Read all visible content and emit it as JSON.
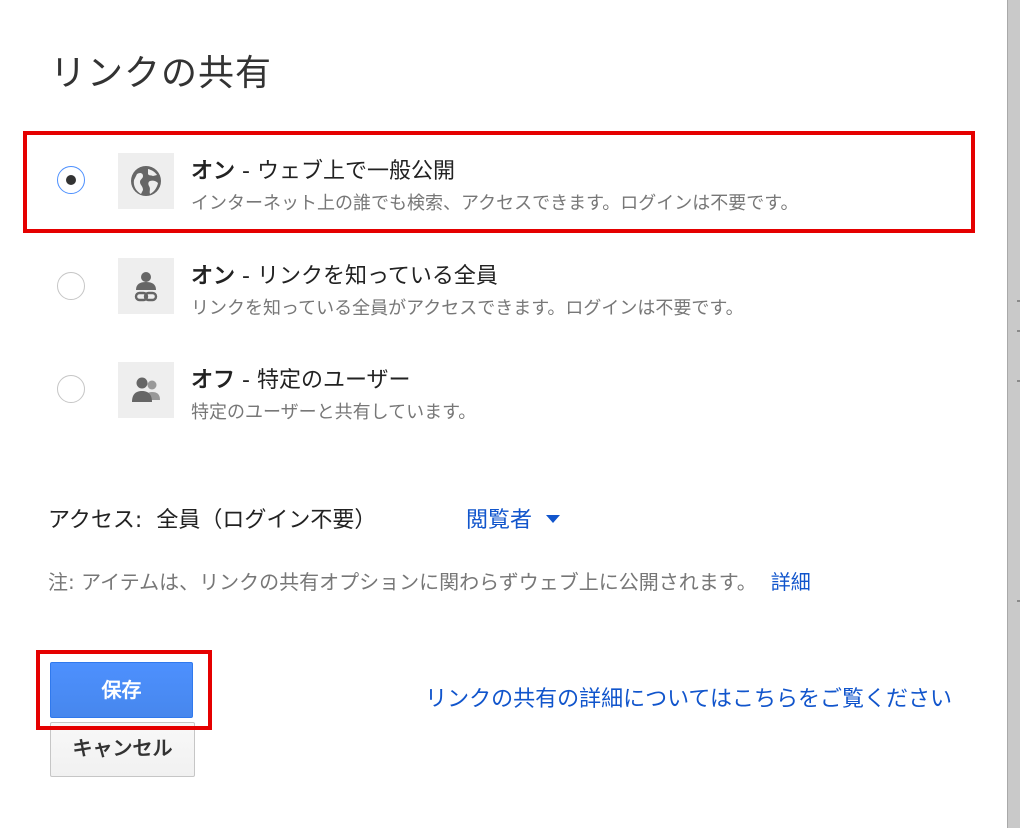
{
  "dialog": {
    "title": "リンクの共有"
  },
  "options": [
    {
      "strong": "オン",
      "rest": " - ウェブ上で一般公開",
      "description": "インターネット上の誰でも検索、アクセスできます。ログインは不要です。",
      "icon": "globe-icon",
      "selected": true
    },
    {
      "strong": "オン",
      "rest": " - リンクを知っている全員",
      "description": "リンクを知っている全員がアクセスできます。ログインは不要です。",
      "icon": "person-link-icon",
      "selected": false
    },
    {
      "strong": "オフ",
      "rest": " - 特定のユーザー",
      "description": "特定のユーザーと共有しています。",
      "icon": "people-icon",
      "selected": false
    }
  ],
  "access": {
    "label": "アクセス:",
    "value": "全員（ログイン不要）",
    "role": "閲覧者"
  },
  "note": {
    "text": "注: アイテムは、リンクの共有オプションに関わらずウェブ上に公開されます。",
    "link": "詳細"
  },
  "buttons": {
    "save": "保存",
    "cancel": "キャンセル"
  },
  "learn_more": "リンクの共有の詳細についてはこちらをご覧ください",
  "colors": {
    "link": "#1155cc",
    "primary_button": "#4d90fe",
    "highlight": "#e50000"
  }
}
